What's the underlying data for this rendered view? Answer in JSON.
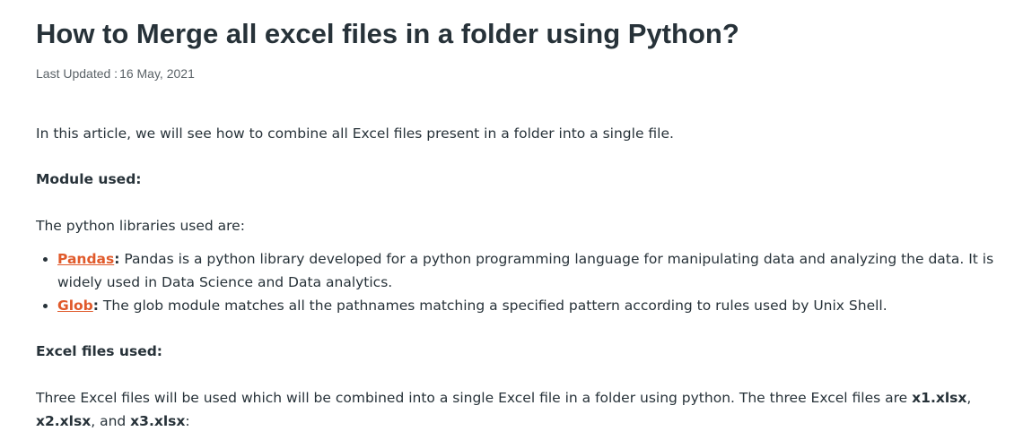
{
  "article": {
    "title": "How to Merge all excel files in a folder using Python?",
    "last_updated_label": "Last Updated :",
    "last_updated_date": "16 May, 2021",
    "intro": "In this article, we will see how to combine all Excel files present in a folder into a single file.",
    "module_heading": "Module used:",
    "libraries_intro": "The python libraries used are:",
    "libraries": [
      {
        "name": "Pandas",
        "description": " Pandas is a python library developed for a python programming language for manipulating data and analyzing the data. It is widely used in Data Science and Data analytics."
      },
      {
        "name": "Glob",
        "description": " The glob module matches all the pathnames matching a specified pattern according to rules used by Unix Shell."
      }
    ],
    "excel_heading": "Excel files used:",
    "files_text_before": "Three Excel files will be used which will be combined into a single Excel file in a folder using python. The three Excel files are ",
    "files": [
      "x1.xlsx",
      "x2.xlsx",
      "x3.xlsx"
    ],
    "files_sep_1": ", ",
    "files_sep_2": ", and ",
    "files_end": ":"
  },
  "colors": {
    "text": "#273239",
    "meta": "#5b6368",
    "link": "#e05a2b"
  }
}
